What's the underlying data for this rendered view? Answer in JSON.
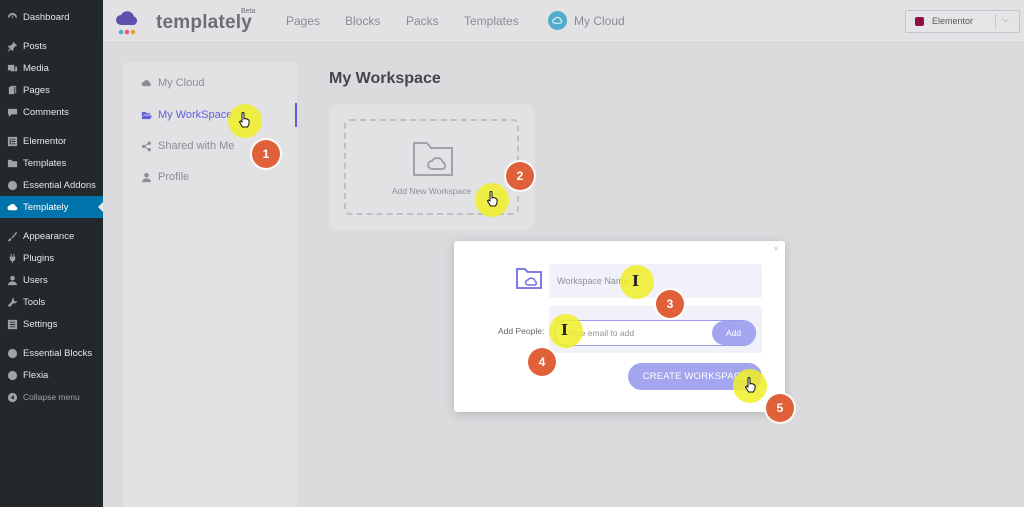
{
  "wp_sidebar": {
    "items": [
      {
        "label": "Dashboard",
        "icon": "dashboard-icon"
      },
      {
        "label": "Posts",
        "icon": "pin-icon"
      },
      {
        "label": "Media",
        "icon": "media-icon"
      },
      {
        "label": "Pages",
        "icon": "pages-icon"
      },
      {
        "label": "Comments",
        "icon": "comment-icon"
      },
      {
        "label": "Elementor",
        "icon": "elementor-icon"
      },
      {
        "label": "Templates",
        "icon": "folder-icon"
      },
      {
        "label": "Essential Addons",
        "icon": "ea-icon"
      },
      {
        "label": "Templately",
        "icon": "templately-icon",
        "active": true
      },
      {
        "label": "Appearance",
        "icon": "brush-icon"
      },
      {
        "label": "Plugins",
        "icon": "plug-icon"
      },
      {
        "label": "Users",
        "icon": "user-icon"
      },
      {
        "label": "Tools",
        "icon": "wrench-icon"
      },
      {
        "label": "Settings",
        "icon": "settings-icon"
      },
      {
        "label": "Essential Blocks",
        "icon": "eb-icon"
      },
      {
        "label": "Flexia",
        "icon": "flexia-icon"
      },
      {
        "label": "Collapse menu",
        "icon": "collapse-icon"
      }
    ]
  },
  "header": {
    "logo_text": "templately",
    "logo_badge": "Beta",
    "nav": [
      "Pages",
      "Blocks",
      "Packs",
      "Templates",
      "My Cloud"
    ],
    "builder_select": "Elementor"
  },
  "left_panel": {
    "items": [
      {
        "label": "My Cloud",
        "icon": "cloud-icon"
      },
      {
        "label": "My WorkSpace",
        "icon": "folder-open-icon",
        "active": true
      },
      {
        "label": "Shared with Me",
        "icon": "share-icon"
      },
      {
        "label": "Profile",
        "icon": "user-icon"
      }
    ]
  },
  "main": {
    "title": "My Workspace",
    "new_card_label": "Add New Workspace"
  },
  "modal": {
    "close": "×",
    "name_placeholder": "Workspace Name",
    "add_people_label": "Add People:",
    "email_placeholder": "Type email to add",
    "add_button": "Add",
    "create_button": "CREATE WORKSPACE"
  },
  "steps": [
    "1",
    "2",
    "3",
    "4",
    "5"
  ],
  "colors": {
    "wp_sidebar": "#23282d",
    "wp_active": "#0073aa",
    "accent": "#5b5ce2",
    "button": "#a4a5ef",
    "highlight": "#f0ee28",
    "step_badge": "#e0603a"
  }
}
